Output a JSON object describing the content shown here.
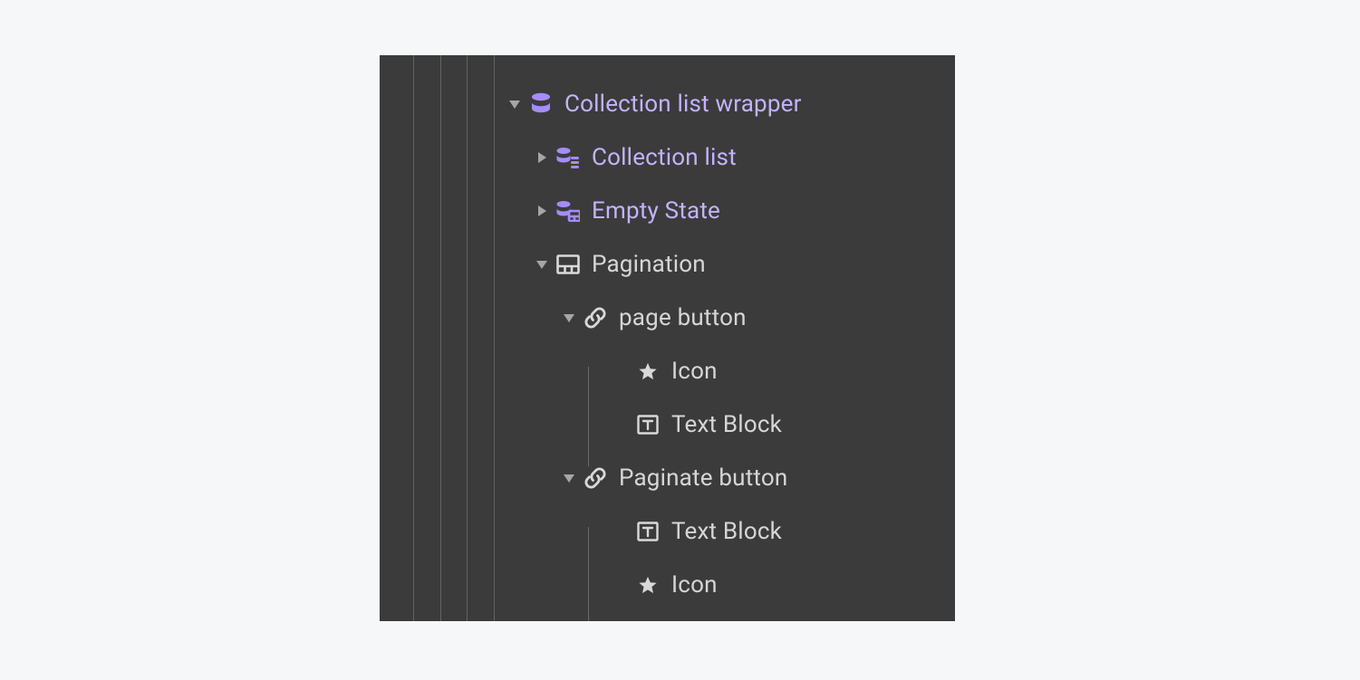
{
  "colors": {
    "panel_bg": "#3b3b3b",
    "accent": "#a48cff",
    "accent_text": "#c3b3ff",
    "text": "#d6d6d6",
    "guide": "#626262"
  },
  "tree": {
    "node0": {
      "label": "Collection list wrapper",
      "icon": "database-icon",
      "expanded": true
    },
    "node1": {
      "label": "Collection list",
      "icon": "database-list-icon",
      "expanded": false
    },
    "node2": {
      "label": "Empty State",
      "icon": "database-layout-icon",
      "expanded": false
    },
    "node3": {
      "label": "Pagination",
      "icon": "layout-icon",
      "expanded": true
    },
    "node4": {
      "label": "page button",
      "icon": "link-icon",
      "expanded": true
    },
    "node5": {
      "label": "Icon",
      "icon": "star-icon"
    },
    "node6": {
      "label": "Text Block",
      "icon": "text-block-icon"
    },
    "node7": {
      "label": "Paginate button",
      "icon": "link-icon",
      "expanded": true
    },
    "node8": {
      "label": "Text Block",
      "icon": "text-block-icon"
    },
    "node9": {
      "label": "Icon",
      "icon": "star-icon"
    }
  }
}
